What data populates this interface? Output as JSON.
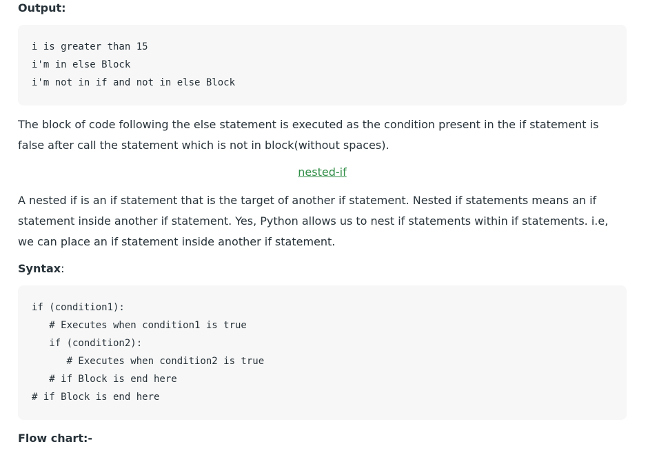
{
  "output_heading": "Output:",
  "output_code": [
    "i is greater than 15",
    "i'm in else Block",
    "i'm not in if and not in else Block"
  ],
  "paragraph_else": "The block of code following the else statement is executed as the condition present in the if statement is false after call the statement which is not in block(without spaces).",
  "nested_if_link": "nested-if",
  "paragraph_nested": "A nested if is an if statement that is the target of another if statement. Nested if statements means an if statement inside another if statement. Yes, Python allows us to nest if statements within if statements. i.e, we can place an if statement inside another if statement.",
  "syntax_heading": "Syntax",
  "syntax_colon": ":",
  "syntax_code": [
    "if (condition1):",
    "   # Executes when condition1 is true",
    "   if (condition2):",
    "      # Executes when condition2 is true",
    "   # if Block is end here",
    "# if Block is end here"
  ],
  "flowchart_heading": "Flow chart:-",
  "colors": {
    "text": "#273239",
    "link": "#2f8d46",
    "code_bg": "#f7f7f7"
  }
}
